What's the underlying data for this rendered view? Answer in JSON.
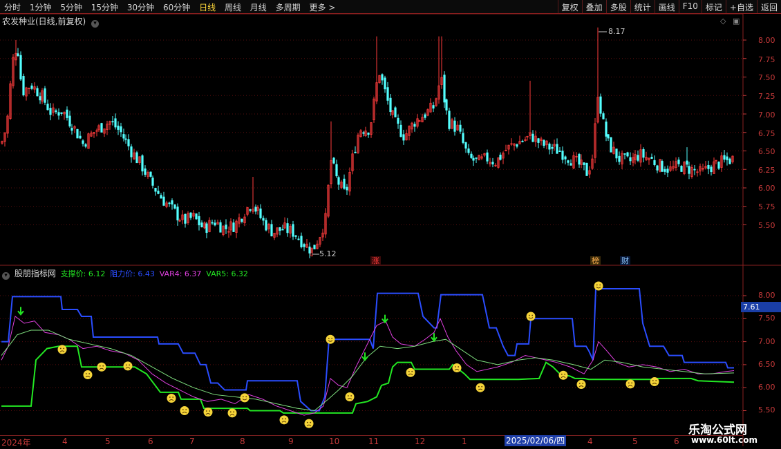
{
  "toolbar": {
    "periods": [
      "分时",
      "1分钟",
      "5分钟",
      "15分钟",
      "30分钟",
      "60分钟",
      "日线",
      "周线",
      "月线",
      "多周期",
      "更多 >"
    ],
    "active_period": "日线",
    "actions": [
      "复权",
      "叠加",
      "多股",
      "统计",
      "画线",
      "F10",
      "标记",
      "+自选",
      "返回"
    ]
  },
  "stock": {
    "title": "农发种业(日线,前复权)",
    "high_label": "8.17",
    "low_label": "5.12"
  },
  "price_axis": [
    "8.00",
    "7.75",
    "7.50",
    "7.25",
    "7.00",
    "6.75",
    "6.50",
    "6.25",
    "6.00",
    "5.75",
    "5.50"
  ],
  "badges": [
    {
      "text": "涨",
      "color": "#ff3b3b",
      "bg": "#3a0a0a"
    },
    {
      "text": "榜",
      "color": "#ffb050",
      "bg": "#3a2a0a"
    },
    {
      "text": "财",
      "color": "#8ec8ff",
      "bg": "#0a1a3a"
    }
  ],
  "indicator": {
    "name": "股朋指标网",
    "support": {
      "label": "支撑价: 6.12",
      "color": "#23e823"
    },
    "resistance": {
      "label": "阻力价: 6.43",
      "color": "#2a4dff"
    },
    "var4": {
      "label": "VAR4: 6.37",
      "color": "#e040e0"
    },
    "var5": {
      "label": "VAR5: 6.32",
      "color": "#23e823"
    },
    "axis": [
      "8.00",
      "7.50",
      "7.00",
      "6.50",
      "6.00",
      "5.50"
    ],
    "current_price": "7.61"
  },
  "dates": [
    "2024年",
    "4",
    "5",
    "6",
    "7",
    "8",
    "9",
    "10",
    "11",
    "12",
    "1",
    "4",
    "5",
    "6"
  ],
  "date_cursor": "2025/02/06/四",
  "watermark": {
    "title": "乐淘公式网",
    "url": "www.60lt.com"
  },
  "colors": {
    "up": "#ff3c3c",
    "down": "#54ffff",
    "grid": "#5a0f0f",
    "border": "#8a1f1f"
  }
}
